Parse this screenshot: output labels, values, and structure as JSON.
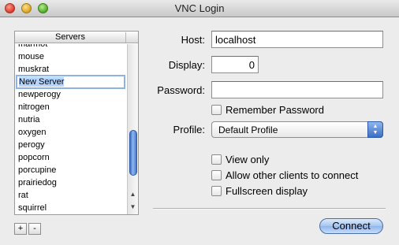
{
  "window": {
    "title": "VNC Login"
  },
  "servers": {
    "header": "Servers",
    "items": [
      {
        "label": "marmot"
      },
      {
        "label": "mouse"
      },
      {
        "label": "muskrat"
      },
      {
        "label": "New Server",
        "editing": true
      },
      {
        "label": "newperogy"
      },
      {
        "label": "nitrogen"
      },
      {
        "label": "nutria"
      },
      {
        "label": "oxygen"
      },
      {
        "label": "perogy"
      },
      {
        "label": "popcorn"
      },
      {
        "label": "porcupine"
      },
      {
        "label": "prairiedog"
      },
      {
        "label": "rat"
      },
      {
        "label": "squirrel"
      }
    ],
    "scroll_up_glyph": "▲",
    "scroll_down_glyph": "▼",
    "add_label": "+",
    "remove_label": "-"
  },
  "form": {
    "host_label": "Host:",
    "host_value": "localhost",
    "display_label": "Display:",
    "display_value": "0",
    "password_label": "Password:",
    "password_value": "",
    "remember_password_label": "Remember Password",
    "profile_label": "Profile:",
    "profile_value": "Default Profile",
    "view_only_label": "View only",
    "allow_others_label": "Allow other clients to connect",
    "fullscreen_label": "Fullscreen display",
    "connect_label": "Connect"
  },
  "checkboxes": {
    "remember_password": false,
    "view_only": false,
    "allow_others": false,
    "fullscreen": false
  },
  "colors": {
    "accent": "#3b6ec4",
    "selection": "#b5d5ff"
  }
}
